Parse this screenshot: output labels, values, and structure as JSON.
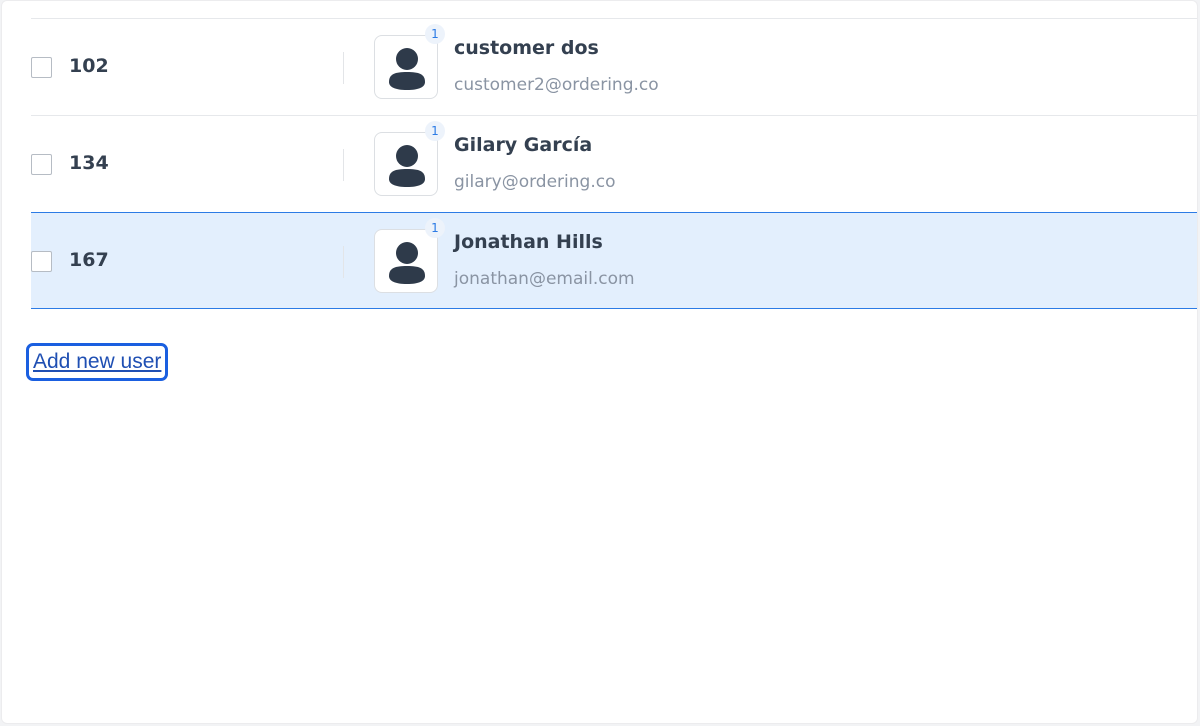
{
  "users": [
    {
      "id": "102",
      "name": "customer dos",
      "email": "customer2@ordering.co",
      "badge": "1",
      "selected": false
    },
    {
      "id": "134",
      "name": "Gilary García",
      "email": "gilary@ordering.co",
      "badge": "1",
      "selected": false
    },
    {
      "id": "167",
      "name": "Jonathan Hills",
      "email": "jonathan@email.com",
      "badge": "1",
      "selected": true
    }
  ],
  "actions": {
    "add_user_label": "Add new user"
  },
  "colors": {
    "accent": "#2c7be5",
    "selected_row_bg": "#e3effd",
    "avatar_icon": "#344050"
  },
  "icons": {
    "avatar": "user-silhouette-icon",
    "checkbox": "checkbox-icon"
  }
}
